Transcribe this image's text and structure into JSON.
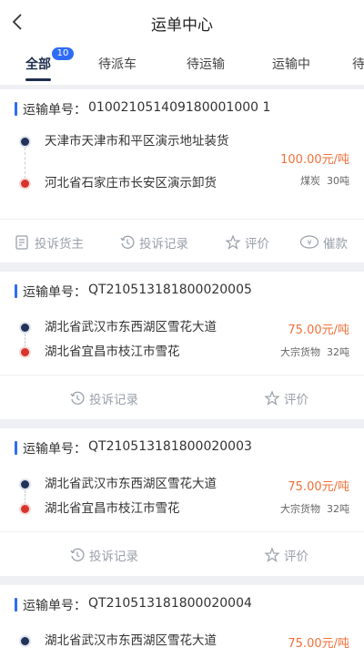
{
  "header": {
    "title": "运单中心",
    "back_icon": "chevron-left-icon"
  },
  "tabs": [
    {
      "label": "全部",
      "badge": "10",
      "active": true
    },
    {
      "label": "待派车"
    },
    {
      "label": "待运输"
    },
    {
      "label": "运输中"
    },
    {
      "label": "待"
    }
  ],
  "colors": {
    "accent": "#2f6cf6",
    "price": "#f0713a",
    "start_dot": "#22335a",
    "end_dot": "#d9342b"
  },
  "orders": [
    {
      "label": "运输单号：",
      "number": "010021051409180001000 1",
      "from": "天津市天津市和平区演示地址装货",
      "to": "河北省石家庄市长安区演示卸货",
      "price": "100.00元/吨",
      "goods": "煤炭",
      "weight": "30吨",
      "actions": [
        "投诉货主",
        "投诉记录",
        "评价",
        "催款"
      ]
    },
    {
      "label": "运输单号：",
      "number": "QT210513181800020005",
      "from": "湖北省武汉市东西湖区雪花大道",
      "to": "湖北省宜昌市枝江市雪花",
      "price": "75.00元/吨",
      "goods": "大宗货物",
      "weight": "32吨",
      "actions": [
        "投诉记录",
        "评价"
      ]
    },
    {
      "label": "运输单号：",
      "number": "QT210513181800020003",
      "from": "湖北省武汉市东西湖区雪花大道",
      "to": "湖北省宜昌市枝江市雪花",
      "price": "75.00元/吨",
      "goods": "大宗货物",
      "weight": "32吨",
      "actions": [
        "投诉记录",
        "评价"
      ]
    },
    {
      "label": "运输单号：",
      "number": "QT210513181800020004",
      "from": "湖北省武汉市东西湖区雪花大道",
      "price": "75.00元/吨"
    }
  ]
}
